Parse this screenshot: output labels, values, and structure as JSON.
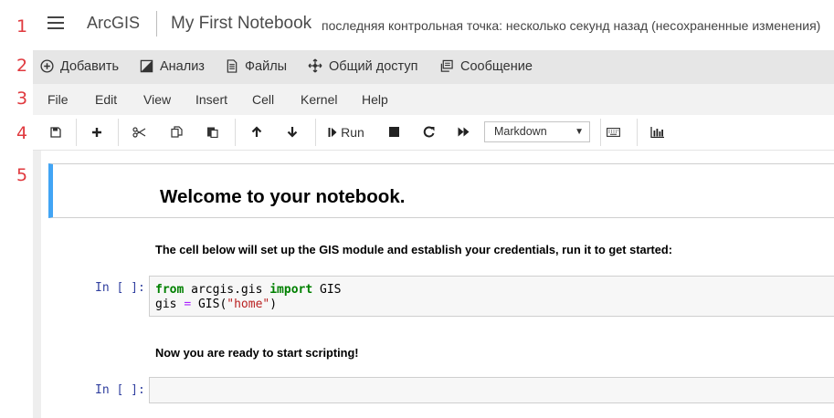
{
  "callouts": [
    "1",
    "2",
    "3",
    "4",
    "5"
  ],
  "header": {
    "app_title": "ArcGIS",
    "notebook_name": "My First Notebook",
    "checkpoint_status": "последняя контрольная точка: несколько секунд назад (несохраненные изменения)"
  },
  "arcgis_toolbar": {
    "items": [
      {
        "label": "Добавить",
        "icon": "plus-circle-icon"
      },
      {
        "label": "Анализ",
        "icon": "analysis-icon"
      },
      {
        "label": "Файлы",
        "icon": "file-icon"
      },
      {
        "label": "Общий доступ",
        "icon": "share-icon"
      },
      {
        "label": "Сообщение",
        "icon": "message-icon"
      }
    ]
  },
  "menu": {
    "items": [
      "File",
      "Edit",
      "View",
      "Insert",
      "Cell",
      "Kernel",
      "Help"
    ]
  },
  "toolbar": {
    "run_label": "Run",
    "cell_type": "Markdown",
    "icons": [
      "save-icon",
      "insert-cell-icon",
      "cut-icon",
      "copy-icon",
      "paste-icon",
      "move-up-icon",
      "move-down-icon",
      "run-icon",
      "stop-icon",
      "restart-icon",
      "fast-forward-icon",
      "keyboard-icon",
      "chart-icon"
    ]
  },
  "notebook": {
    "welcome_heading": "Welcome to your notebook.",
    "intro_text": "The cell below will set up the GIS module and establish your credentials, run it to get started:",
    "prompt_1": "In [ ]:",
    "code_1": {
      "kw_from": "from",
      "module": " arcgis.gis ",
      "kw_import": "import",
      "name": " GIS",
      "var": "gis ",
      "eq": "=",
      "call": " GIS(",
      "arg": "\"home\"",
      "close": ")"
    },
    "ready_text": "Now you are ready to start scripting!",
    "prompt_2": "In [ ]:"
  }
}
